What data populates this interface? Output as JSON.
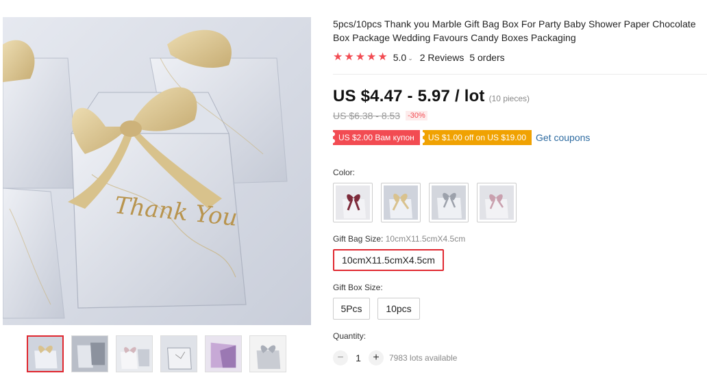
{
  "product": {
    "title": "5pcs/10pcs Thank you Marble Gift Bag Box For Party Baby Shower Paper Chocolate Box Package Wedding Favours Candy Boxes Packaging",
    "image_text": "Thank You"
  },
  "rating": {
    "stars_count": 5,
    "star_glyph": "★",
    "value": "5.0",
    "caret": "⌄",
    "reviews": "2 Reviews",
    "orders": "5 orders"
  },
  "price": {
    "current": "US $4.47 - 5.97 / lot",
    "pieces": "(10 pieces)",
    "original": "US $6.38 - 8.53",
    "discount": "-30%"
  },
  "coupons": {
    "items": [
      "US $2.00 Вам купон",
      "US $1.00 off on US $19.00"
    ],
    "link": "Get coupons"
  },
  "color": {
    "label": "Color:",
    "swatches": [
      "swatch-burgundy-ribbon",
      "swatch-gold-ribbon",
      "swatch-grey-ribbon",
      "swatch-pink-ribbon"
    ]
  },
  "bag_size": {
    "label": "Gift Bag Size:",
    "selected": "10cmX11.5cmX4.5cm",
    "options": [
      "10cmX11.5cmX4.5cm"
    ]
  },
  "box_size": {
    "label": "Gift Box Size:",
    "options": [
      "5Pcs",
      "10pcs"
    ]
  },
  "quantity": {
    "label": "Quantity:",
    "minus": "−",
    "plus": "+",
    "value": "1",
    "available": "7983 lots available"
  },
  "gallery": {
    "thumbnail_count": 6,
    "active_index": 0
  },
  "colors": {
    "accent_red": "#e0272f",
    "star_red": "#f24b52",
    "coupon_orange": "#f0a202",
    "link_blue": "#2c6aa0",
    "ribbon_gold": "#d9c28e"
  }
}
